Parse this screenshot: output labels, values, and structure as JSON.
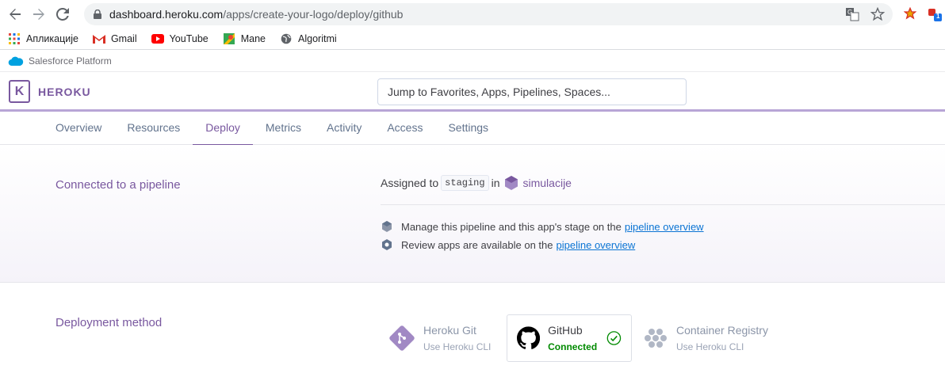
{
  "browser": {
    "url_host": "dashboard.heroku.com",
    "url_path": "/apps/create-your-logo/deploy/github",
    "bookmarks": [
      {
        "label": "Апликације",
        "icon": "apps-grid-icon"
      },
      {
        "label": "Gmail",
        "icon": "gmail-icon"
      },
      {
        "label": "YouTube",
        "icon": "youtube-icon"
      },
      {
        "label": "Mane",
        "icon": "maps-icon"
      },
      {
        "label": "Algoritmi",
        "icon": "globe-icon"
      }
    ],
    "ext_badge": "1"
  },
  "salesforce_bar": {
    "label": "Salesforce Platform"
  },
  "header": {
    "logo_text": "HEROKU",
    "logo_glyph": "K",
    "search_placeholder": "Jump to Favorites, Apps, Pipelines, Spaces..."
  },
  "tabs": [
    {
      "label": "Overview",
      "active": false
    },
    {
      "label": "Resources",
      "active": false
    },
    {
      "label": "Deploy",
      "active": true
    },
    {
      "label": "Metrics",
      "active": false
    },
    {
      "label": "Activity",
      "active": false
    },
    {
      "label": "Access",
      "active": false
    },
    {
      "label": "Settings",
      "active": false
    }
  ],
  "pipeline": {
    "title": "Connected to a pipeline",
    "assigned_prefix": "Assigned to",
    "stage": "staging",
    "in_word": "in",
    "pipeline_name": "simulacije",
    "info1_text": "Manage this pipeline and this app's stage on the",
    "info2_text": "Review apps are available on the",
    "link_text": "pipeline overview"
  },
  "deployment": {
    "title": "Deployment method",
    "methods": [
      {
        "title": "Heroku Git",
        "sub": "Use Heroku CLI"
      },
      {
        "title": "GitHub",
        "sub": "Connected"
      },
      {
        "title": "Container Registry",
        "sub": "Use Heroku CLI"
      }
    ]
  },
  "colors": {
    "brand": "#79589f",
    "link": "#0b74d4",
    "connected": "#008a00"
  }
}
